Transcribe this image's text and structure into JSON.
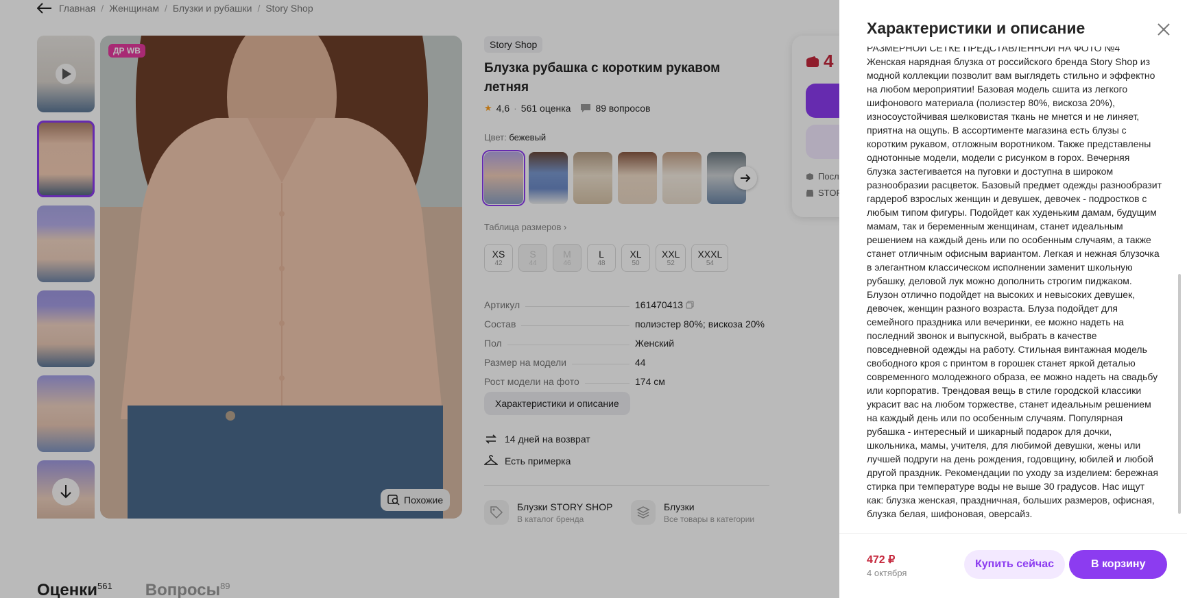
{
  "breadcrumbs": [
    "Главная",
    "Женщинам",
    "Блузки и рубашки",
    "Story Shop"
  ],
  "product": {
    "badge": "ДР WB",
    "similar_label": "Похожие",
    "brand": "Story Shop",
    "title": "Блузка рубашка с коротким рукавом летняя",
    "rating": "4,6",
    "rating_sep": "·",
    "reviews": "561 оценка",
    "questions": "89 вопросов",
    "color_label": "Цвет:",
    "color_value": "бежевый",
    "size_table_link": "Таблица размеров",
    "sizes": [
      {
        "s": "XS",
        "n": "42",
        "available": true
      },
      {
        "s": "S",
        "n": "44",
        "available": false
      },
      {
        "s": "M",
        "n": "46",
        "available": false
      },
      {
        "s": "L",
        "n": "48",
        "available": true
      },
      {
        "s": "XL",
        "n": "50",
        "available": true
      },
      {
        "s": "XXL",
        "n": "52",
        "available": true
      },
      {
        "s": "XXXL",
        "n": "54",
        "available": true
      }
    ],
    "specs": [
      {
        "k": "Артикул",
        "v": "161470413"
      },
      {
        "k": "Состав",
        "v": "полиэстер 80%; вискоза 20%"
      },
      {
        "k": "Пол",
        "v": "Женский"
      },
      {
        "k": "Размер на модели",
        "v": "44"
      },
      {
        "k": "Рост модели на фото",
        "v": "174 см"
      }
    ],
    "desc_button": "Характеристики и описание",
    "perks": [
      "14 дней на возврат",
      "Есть примерка"
    ],
    "cards": [
      {
        "t1": "Блузки STORY SHOP",
        "t2": "В каталог бренда"
      },
      {
        "t1": "Блузки",
        "t2": "Все товары в категории"
      }
    ],
    "buybox_price_fragment": "4",
    "buybox_text_1": "Посл",
    "buybox_text_2": "STOR"
  },
  "tabs": [
    {
      "label": "Оценки",
      "count": "561"
    },
    {
      "label": "Вопросы",
      "count": "89"
    }
  ],
  "drawer": {
    "title": "Характеристики и описание",
    "clipped_line": "РАЗМЕРНОЙ СЕТКЕ ПРЕДСТАВЛЕННОЙ НА ФОТО №4",
    "description": "Женская нарядная блузка от российского бренда Story Shop из модной коллекции позволит вам выглядеть стильно и эффектно на любом мероприятии! Базовая модель сшита из легкого шифонового материала (полиэстер 80%, вискоза 20%), износоустойчивая шелковистая ткань не мнется и не линяет, приятна на ощупь. В ассортименте магазина есть блузы с коротким рукавом, отложным воротником. Также представлены однотонные модели, модели с рисунком в горох. Вечерняя блузка застегивается на пуговки и доступна в широком разнообразии расцветок. Базовый предмет одежды разнообразит гардероб взрослых женщин и девушек, девочек - подростков с любым типом фигуры. Подойдет как худеньким дамам, будущим мамам, так и беременным женщинам, станет идеальным решением на каждый день или по особенным случаям, а также станет отличным офисным вариантом. Легкая и нежная блузочка в элегантном классическом исполнении заменит школьную рубашку, деловой лук можно дополнить строгим пиджаком. Блузон отлично подойдет на высоких и невысоких девушек, девочек, женщин разного возраста. Блуза подойдет для семейного праздника или вечеринки, ее можно надеть на последний звонок и выпускной, выбрать в качестве повседневной одежды на работу. Стильная винтажная модель свободного кроя с принтом в горошек станет яркой деталью современного молодежного образа, ее можно надеть на свадьбу или корпоратив. Трендовая вещь в стиле городской классики украсит вас на любом торжестве, станет идеальным решением на каждый день или по особенным случаям. Популярная рубашка - интересный и шикарный подарок для дочки, школьника, мамы, учителя, для любимой девушки, жены или лучшей подруги на день рождения, годовщину, юбилей и любой другой праздник. Рекомендации по уходу за изделием: бережная стирка при температуре воды не выше 30 градусов. Нас ищут как: блузка женская, праздничная, больших размеров, офисная, блузка белая, шифоновая, оверсайз.",
    "price": "472 ₽",
    "date": "4 октября",
    "buy_now": "Купить сейчас",
    "to_cart": "В корзину"
  },
  "colors": {
    "accent": "#8c3cf0",
    "price": "#c5283d",
    "badge": "#e63aa0",
    "overlay": "rgba(0,0,0,0.27)"
  }
}
